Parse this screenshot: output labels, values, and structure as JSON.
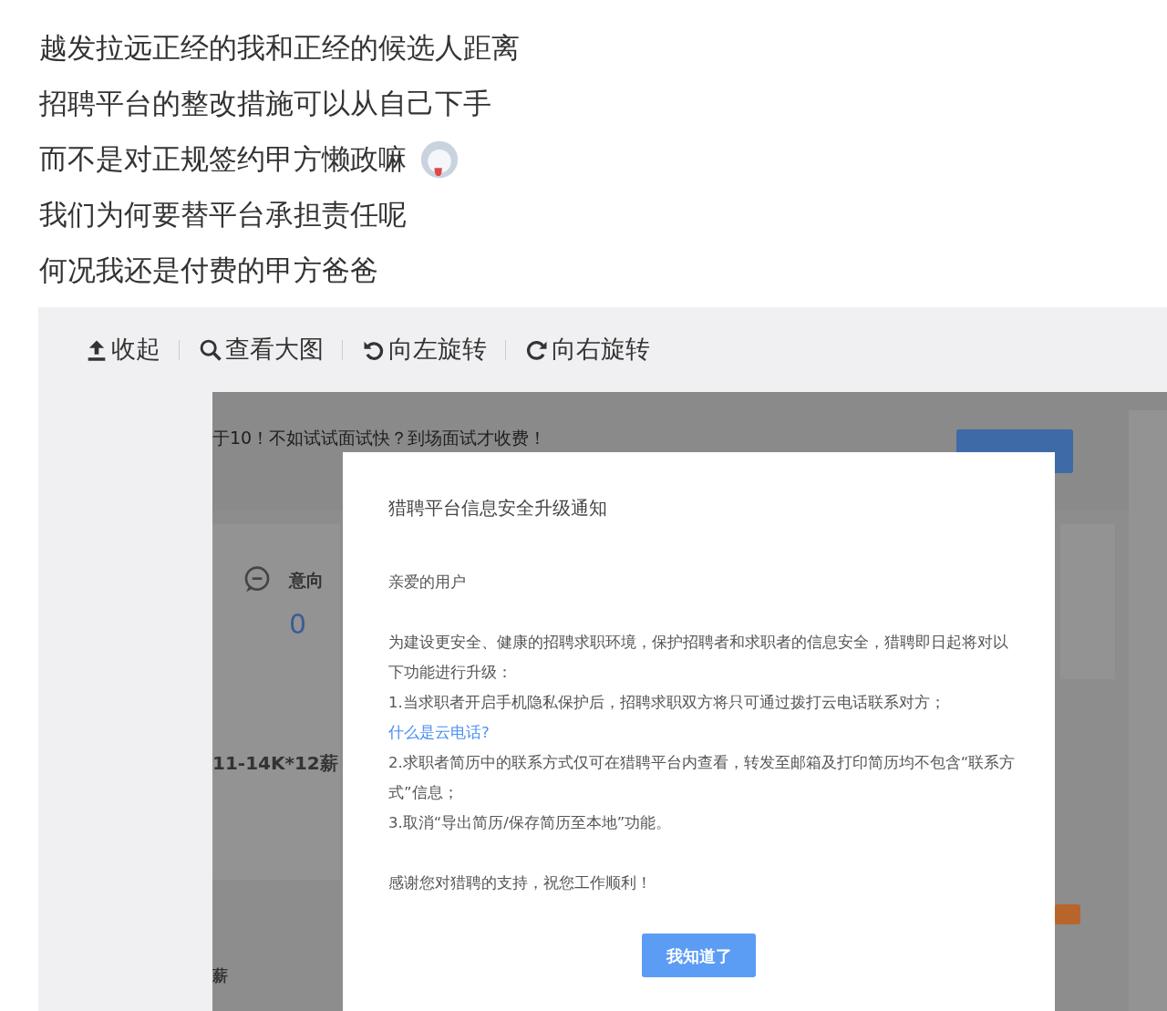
{
  "post": {
    "lines": [
      {
        "text": "越发拉远正经的我和正经的候选人距离",
        "emoji": false
      },
      {
        "text": "招聘平台的整改措施可以从自己下手",
        "emoji": false
      },
      {
        "text": "而不是对正规签约甲方懒政嘛",
        "emoji": true
      },
      {
        "text": "我们为何要替平台承担责任呢",
        "emoji": false
      },
      {
        "text": "何况我还是付费的甲方爸爸",
        "emoji": false
      }
    ]
  },
  "image_toolbar": {
    "buttons": [
      {
        "label": "收起",
        "kind": "collapse"
      },
      {
        "label": "查看大图",
        "kind": "zoom"
      },
      {
        "label": "向左旋转",
        "kind": "rotate_left"
      },
      {
        "label": "向右旋转",
        "kind": "rotate_right"
      }
    ]
  },
  "screenshot": {
    "background": {
      "banner": "于10！不如试试面试快？到场面试才收费！",
      "stat_label": "意向",
      "stat_value": "0",
      "salary": "11-14K*12薪",
      "salary_2": "薪"
    },
    "dialog": {
      "title": "猎聘平台信息安全升级通知",
      "greeting": "亲爱的用户",
      "intro": "为建设更安全、健康的招聘求职环境，保护招聘者和求职者的信息安全，猎聘即日起将对以下功能进行升级：",
      "items": [
        {
          "text": "1.当求职者开启手机隐私保护后，招聘求职双方将只可通过拨打云电话联系对方；",
          "link": "什么是云电话?"
        },
        {
          "text": "2.求职者简历中的联系方式仅可在猎聘平台内查看，转发至邮箱及打印简历均不包含“联系方式”信息；"
        },
        {
          "text": "3.取消“导出简历/保存简历至本地”功能。"
        }
      ],
      "thanks": "感谢您对猎聘的支持，祝您工作顺利！",
      "button": "我知道了"
    }
  }
}
